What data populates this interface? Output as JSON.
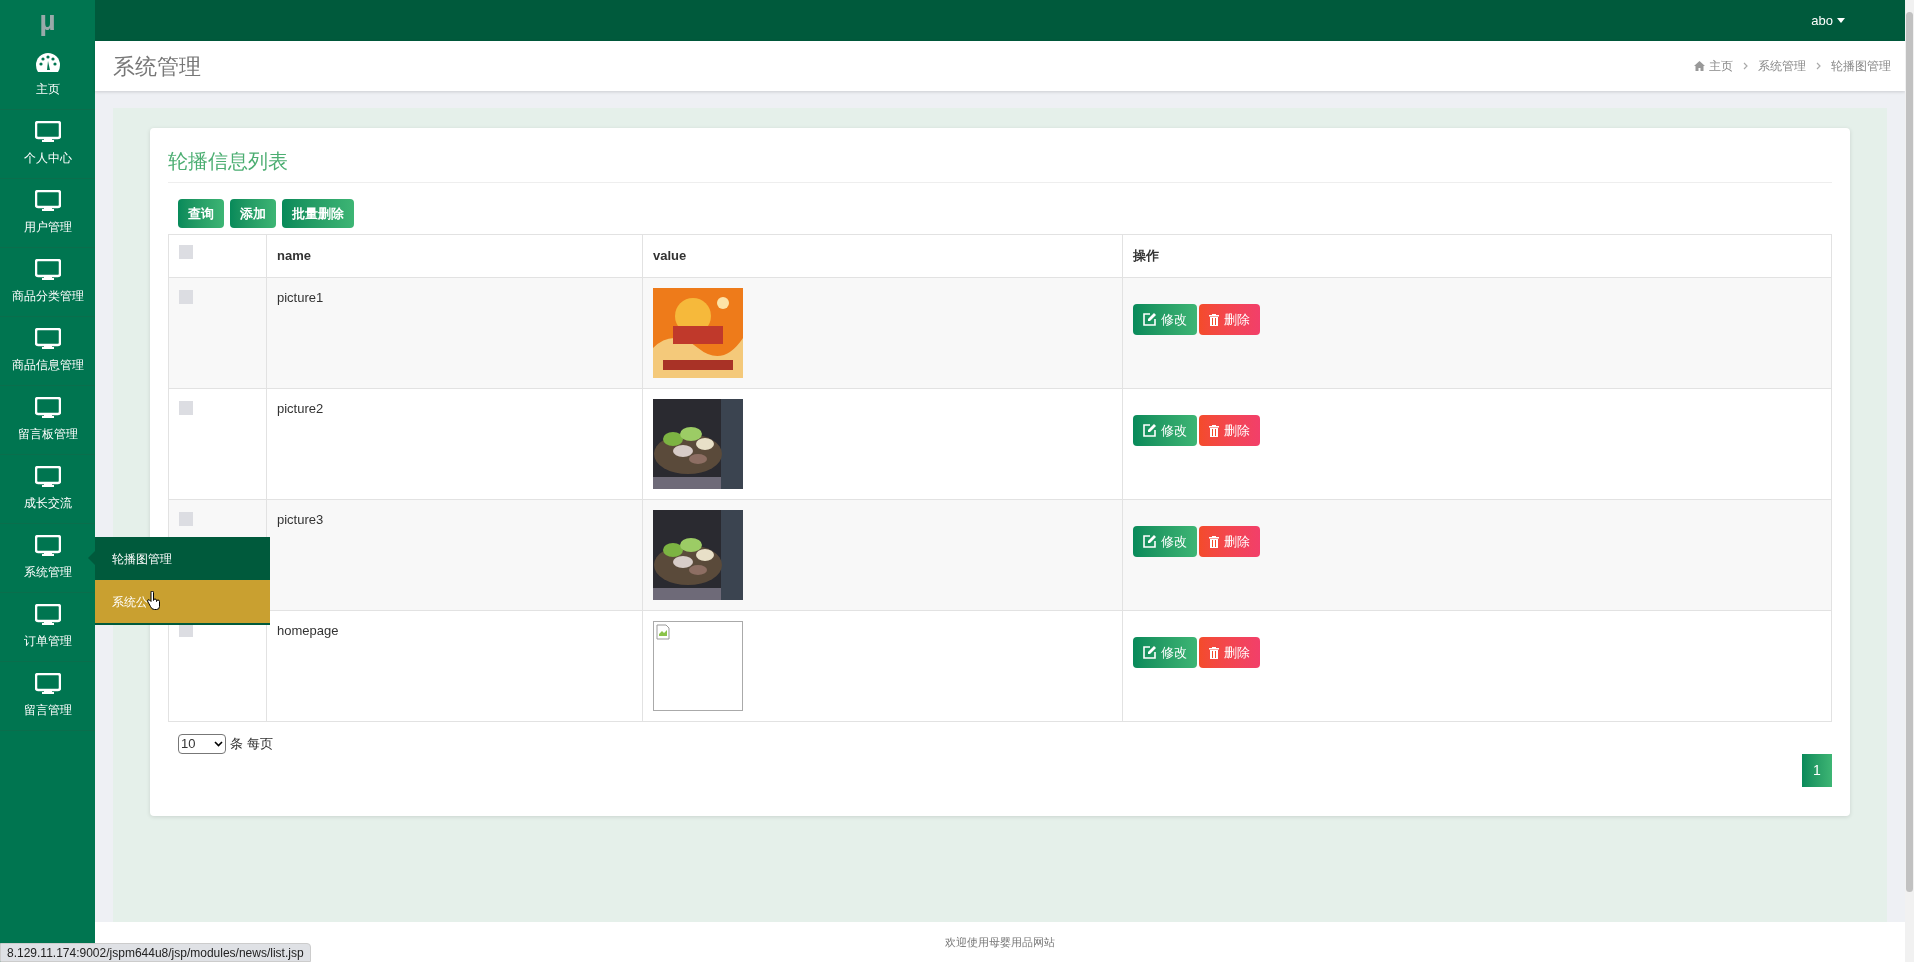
{
  "brand": "µ",
  "user": {
    "name": "abo"
  },
  "sidebar": {
    "items": [
      {
        "label": "主页",
        "kind": "dashboard"
      },
      {
        "label": "个人中心",
        "kind": "monitor"
      },
      {
        "label": "用户管理",
        "kind": "monitor"
      },
      {
        "label": "商品分类管理",
        "kind": "monitor"
      },
      {
        "label": "商品信息管理",
        "kind": "monitor"
      },
      {
        "label": "留言板管理",
        "kind": "monitor"
      },
      {
        "label": "成长交流",
        "kind": "monitor"
      },
      {
        "label": "系统管理",
        "kind": "monitor",
        "expanded": true,
        "children": [
          {
            "label": "轮播图管理",
            "hovered": false
          },
          {
            "label": "系统公",
            "hovered": true
          }
        ]
      },
      {
        "label": "订单管理",
        "kind": "monitor"
      },
      {
        "label": "留言管理",
        "kind": "monitor"
      }
    ]
  },
  "page_header": {
    "title": "系统管理",
    "breadcrumb": [
      "主页",
      "系统管理",
      "轮播图管理"
    ]
  },
  "card": {
    "title": "轮播信息列表",
    "buttons": [
      "查询",
      "添加",
      "批量删除"
    ]
  },
  "table": {
    "columns": [
      "name",
      "value",
      "操作"
    ],
    "header_checked": false,
    "rows": [
      {
        "checked": false,
        "name": "picture1",
        "value": {
          "kind": "banner"
        },
        "actions": [
          "修改",
          "删除"
        ]
      },
      {
        "checked": false,
        "name": "picture2",
        "value": {
          "kind": "food"
        },
        "actions": [
          "修改",
          "删除"
        ]
      },
      {
        "checked": false,
        "name": "picture3",
        "value": {
          "kind": "food"
        },
        "actions": [
          "修改",
          "删除"
        ]
      },
      {
        "checked": false,
        "name": "homepage",
        "value": {
          "kind": "broken"
        },
        "actions": [
          "修改",
          "删除"
        ]
      }
    ]
  },
  "pager": {
    "page_size": "10",
    "page_size_label": "条 每页",
    "pages": [
      {
        "label": "1",
        "selected": true
      }
    ]
  },
  "footer": "欢迎使用母婴用品网站",
  "status_url": "8.129.11.174:9002/jspm644u8/jsp/modules/news/list.jsp"
}
